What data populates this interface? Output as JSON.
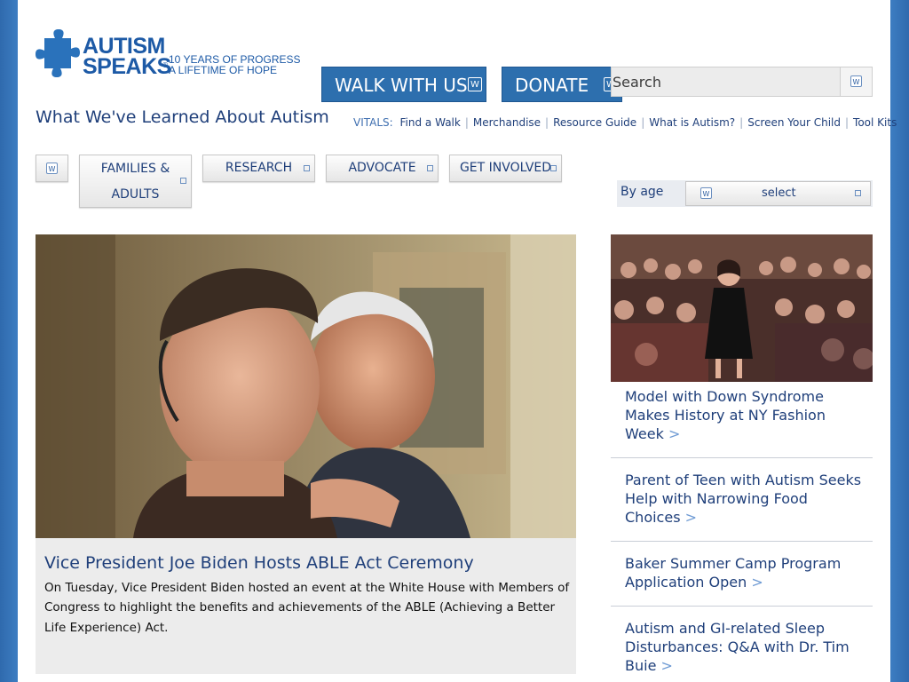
{
  "logo": {
    "line1": "AUTISM",
    "line2": "SPEAKS",
    "reg": "®",
    "tagline1": "10 YEARS OF PROGRESS",
    "tagline2": "A LIFETIME OF HOPE"
  },
  "header": {
    "walk_label": "WALK WITH US",
    "donate_label": "DONATE",
    "search_placeholder": "Search",
    "subtitle": "What We've Learned About Autism"
  },
  "vitals": {
    "label": "VITALS:",
    "links": [
      "Find a Walk",
      "Merchandise",
      "Resource Guide",
      "What is Autism?",
      "Screen Your Child",
      "Tool Kits"
    ],
    "separator": "|"
  },
  "nav": {
    "families_line1": "FAMILIES &",
    "families_line2": "ADULTS",
    "research": "RESEARCH",
    "advocate": "ADVOCATE",
    "involved": "GET INVOLVED"
  },
  "byage": {
    "label": "By age",
    "value": "select"
  },
  "hero": {
    "title": "Vice President Joe Biden Hosts ABLE Act Ceremony",
    "text": "On Tuesday, Vice President Biden hosted an event at the White House with Members of Congress to highlight the benefits and achievements of the ABLE (Achieving a Better Life Experience) Act."
  },
  "side": {
    "items": [
      {
        "title": "Model with Down Syndrome Makes History at NY Fashion Week"
      },
      {
        "title": "Parent of Teen with Autism Seeks Help with Narrowing Food Choices"
      },
      {
        "title": "Baker Summer Camp Program Application Open"
      },
      {
        "title": "Autism and GI-related Sleep Disturbances: Q&A with Dr. Tim Buie"
      }
    ],
    "arrow": ">"
  },
  "icons": {
    "logo": "puzzle-piece-icon",
    "button_badge": "w-badge-icon",
    "dropdown": "dropdown-indicator-icon"
  },
  "colors": {
    "brand_blue": "#1d5aa6",
    "button_blue": "#2d6fae",
    "text_navy": "#1f3f7a",
    "panel_gray": "#ececec"
  }
}
